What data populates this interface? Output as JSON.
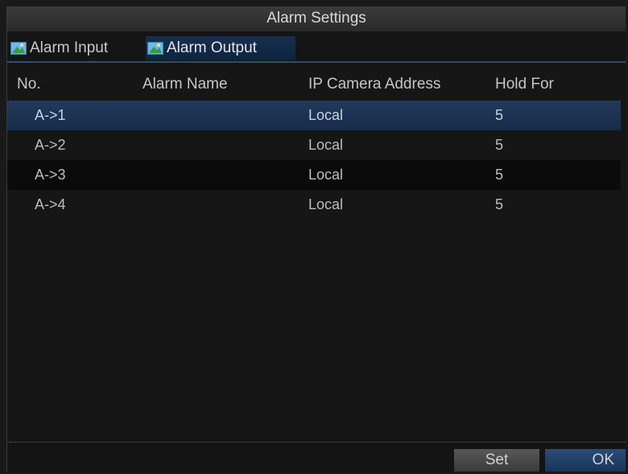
{
  "window": {
    "title": "Alarm Settings"
  },
  "tabs": [
    {
      "label": "Alarm Input",
      "icon": "alarm-input-icon",
      "active": false
    },
    {
      "label": "Alarm Output",
      "icon": "alarm-output-icon",
      "active": true
    }
  ],
  "table": {
    "columns": [
      "No.",
      "Alarm Name",
      "IP Camera Address",
      "Hold For"
    ],
    "rows": [
      {
        "no": "A->1",
        "name": "",
        "address": "Local",
        "hold": "5"
      },
      {
        "no": "A->2",
        "name": "",
        "address": "Local",
        "hold": "5"
      },
      {
        "no": "A->3",
        "name": "",
        "address": "Local",
        "hold": "5"
      },
      {
        "no": "A->4",
        "name": "",
        "address": "Local",
        "hold": "5"
      }
    ]
  },
  "buttons": {
    "set": "Set",
    "ok": "OK"
  },
  "colors": {
    "selection": "#213a5c",
    "accent": "#2d4d78"
  }
}
